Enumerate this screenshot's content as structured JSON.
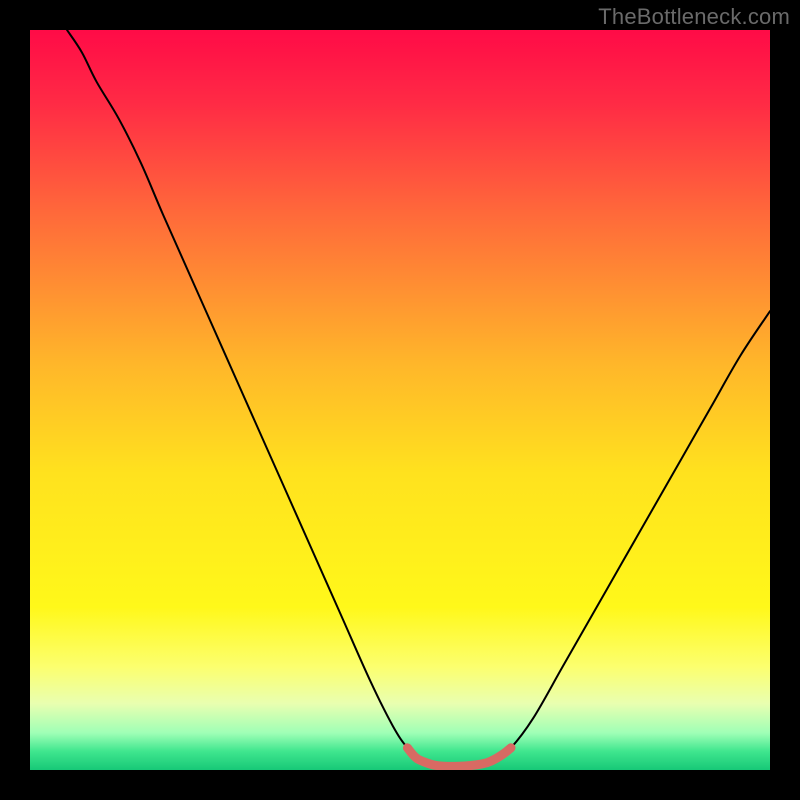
{
  "watermark": "TheBottleneck.com",
  "chart_data": {
    "type": "line",
    "title": "",
    "xlabel": "",
    "ylabel": "",
    "xlim": [
      0,
      100
    ],
    "ylim": [
      0,
      100
    ],
    "grid": false,
    "legend": false,
    "background": {
      "type": "vertical-gradient",
      "stops": [
        {
          "pos": 0.0,
          "color": "#ff0b47"
        },
        {
          "pos": 0.1,
          "color": "#ff2b45"
        },
        {
          "pos": 0.25,
          "color": "#ff6a3a"
        },
        {
          "pos": 0.45,
          "color": "#ffb62a"
        },
        {
          "pos": 0.6,
          "color": "#ffe21e"
        },
        {
          "pos": 0.78,
          "color": "#fff81a"
        },
        {
          "pos": 0.86,
          "color": "#fcff6e"
        },
        {
          "pos": 0.91,
          "color": "#e9ffb0"
        },
        {
          "pos": 0.95,
          "color": "#9fffb6"
        },
        {
          "pos": 0.975,
          "color": "#3fe68e"
        },
        {
          "pos": 1.0,
          "color": "#17c877"
        }
      ]
    },
    "series": [
      {
        "name": "bottleneck-curve",
        "color": "#000000",
        "width": 2,
        "points": [
          {
            "x": 5,
            "y": 100
          },
          {
            "x": 7,
            "y": 97
          },
          {
            "x": 9,
            "y": 93
          },
          {
            "x": 12,
            "y": 88
          },
          {
            "x": 15,
            "y": 82
          },
          {
            "x": 18,
            "y": 75
          },
          {
            "x": 22,
            "y": 66
          },
          {
            "x": 26,
            "y": 57
          },
          {
            "x": 30,
            "y": 48
          },
          {
            "x": 34,
            "y": 39
          },
          {
            "x": 38,
            "y": 30
          },
          {
            "x": 42,
            "y": 21
          },
          {
            "x": 46,
            "y": 12
          },
          {
            "x": 49,
            "y": 6
          },
          {
            "x": 51,
            "y": 3
          },
          {
            "x": 53,
            "y": 1.2
          },
          {
            "x": 55,
            "y": 0.6
          },
          {
            "x": 58,
            "y": 0.5
          },
          {
            "x": 61,
            "y": 0.8
          },
          {
            "x": 63,
            "y": 1.5
          },
          {
            "x": 65,
            "y": 3
          },
          {
            "x": 68,
            "y": 7
          },
          {
            "x": 72,
            "y": 14
          },
          {
            "x": 76,
            "y": 21
          },
          {
            "x": 80,
            "y": 28
          },
          {
            "x": 84,
            "y": 35
          },
          {
            "x": 88,
            "y": 42
          },
          {
            "x": 92,
            "y": 49
          },
          {
            "x": 96,
            "y": 56
          },
          {
            "x": 100,
            "y": 62
          }
        ]
      },
      {
        "name": "target-highlight",
        "color": "#d86a63",
        "width": 9,
        "linecap": "round",
        "points": [
          {
            "x": 51,
            "y": 3.0
          },
          {
            "x": 52,
            "y": 1.8
          },
          {
            "x": 53,
            "y": 1.2
          },
          {
            "x": 55,
            "y": 0.6
          },
          {
            "x": 58,
            "y": 0.5
          },
          {
            "x": 61,
            "y": 0.8
          },
          {
            "x": 62.5,
            "y": 1.3
          },
          {
            "x": 64,
            "y": 2.2
          },
          {
            "x": 65,
            "y": 3.0
          }
        ]
      }
    ]
  },
  "plot": {
    "outer_w": 800,
    "outer_h": 800,
    "inner_left": 30,
    "inner_top": 30,
    "inner_w": 740,
    "inner_h": 740
  }
}
